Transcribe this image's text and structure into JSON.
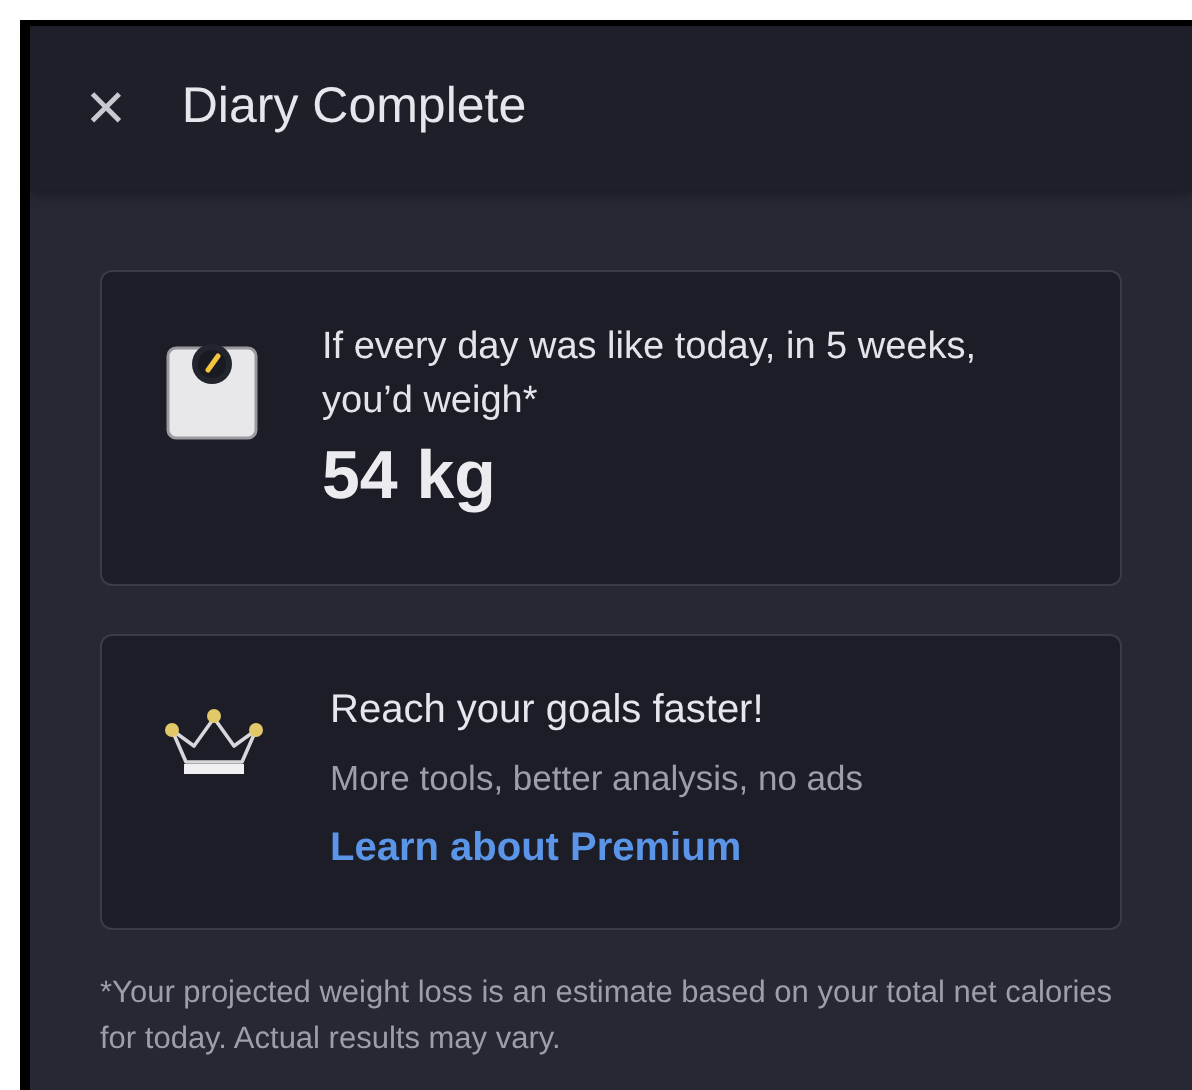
{
  "header": {
    "close_icon": "×",
    "title": "Diary Complete"
  },
  "projection_card": {
    "text": "If every day was like today, in 5 weeks, you’d weigh*",
    "weight": "54 kg"
  },
  "premium_card": {
    "title": "Reach your goals faster!",
    "subtitle": "More tools, better analysis, no ads",
    "link": "Learn about Premium"
  },
  "footnote": "*Your projected weight loss is an estimate based on your total net calories for today. Actual results may vary."
}
